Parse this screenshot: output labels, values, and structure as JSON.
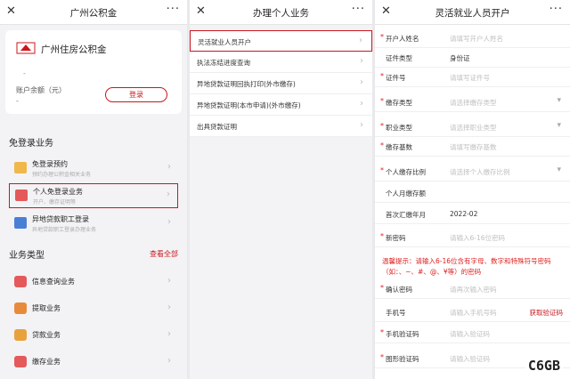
{
  "panel1": {
    "title": "广州公积金",
    "close_icon": "✕",
    "more_icon": "···",
    "brand_name": "广州住房公积金",
    "dash": "-",
    "account_label": "账户余额（元）",
    "account_value": "-",
    "login_label": "登录",
    "section_free": "免登录业务",
    "free_items": [
      {
        "name": "免登录预约",
        "sub": "预约办理公积金相关业务"
      },
      {
        "name": "个人免登录业务",
        "sub": "开户、缴存证明等"
      },
      {
        "name": "异地贷款职工登录",
        "sub": "异地贷款职工登录办理业务"
      }
    ],
    "section_types": "业务类型",
    "view_all": "查看全部",
    "types": [
      {
        "name": "信息查询业务",
        "color": "#e45a5a"
      },
      {
        "name": "提取业务",
        "color": "#e88a3c"
      },
      {
        "name": "贷款业务",
        "color": "#e8a23c"
      },
      {
        "name": "缴存业务",
        "color": "#e45a5a"
      }
    ]
  },
  "panel2": {
    "title": "办理个人业务",
    "items": [
      {
        "name": "灵活就业人员开户"
      },
      {
        "name": "执法冻结进度查询"
      },
      {
        "name": "异地贷款证明回执打印(外市缴存)"
      },
      {
        "name": "异地贷款证明(本市申请)(外市缴存)"
      },
      {
        "name": "出具贷款证明"
      }
    ]
  },
  "panel3": {
    "title": "灵活就业人员开户",
    "rows": [
      {
        "req": "*",
        "label": "开户人姓名",
        "value": "请填写开户人姓名",
        "kind": "input"
      },
      {
        "req": "",
        "label": "证件类型",
        "value": "身份证",
        "kind": "fixed"
      },
      {
        "req": "*",
        "label": "证件号",
        "value": "请填写证件号",
        "kind": "input"
      },
      {
        "req": "*",
        "label": "缴存类型",
        "value": "请选择缴存类型",
        "kind": "select"
      },
      {
        "req": "*",
        "label": "职业类型",
        "value": "请选择职业类型",
        "kind": "select"
      },
      {
        "req": "*",
        "label": "缴存基数",
        "value": "请填写缴存基数",
        "kind": "input"
      },
      {
        "req": "*",
        "label": "个人缴存比例",
        "value": "请选择个人缴存比例",
        "kind": "select"
      },
      {
        "req": "",
        "label": "个人月缴存额",
        "value": "",
        "kind": "fixed"
      },
      {
        "req": "",
        "label": "首次汇缴年月",
        "value": "2022-02",
        "kind": "fixed"
      },
      {
        "req": "*",
        "label": "新密码",
        "value": "请输入6-16位密码",
        "kind": "input"
      },
      {
        "req": "*",
        "label": "确认密码",
        "value": "请再次输入密码",
        "kind": "input"
      },
      {
        "req": "",
        "label": "手机号",
        "value": "请输入手机号码",
        "kind": "sms"
      },
      {
        "req": "*",
        "label": "手机验证码",
        "value": "请输入验证码",
        "kind": "input"
      },
      {
        "req": "*",
        "label": "图形验证码",
        "value": "请输入验证码",
        "kind": "input"
      }
    ],
    "tip": "温馨提示：请输入6-16位含有字母、数字和特殊符号密码（如：、~、#、@、¥等）的密码",
    "sms_label": "获取验证码",
    "arrow": "▾",
    "watermark": "C6GB"
  }
}
